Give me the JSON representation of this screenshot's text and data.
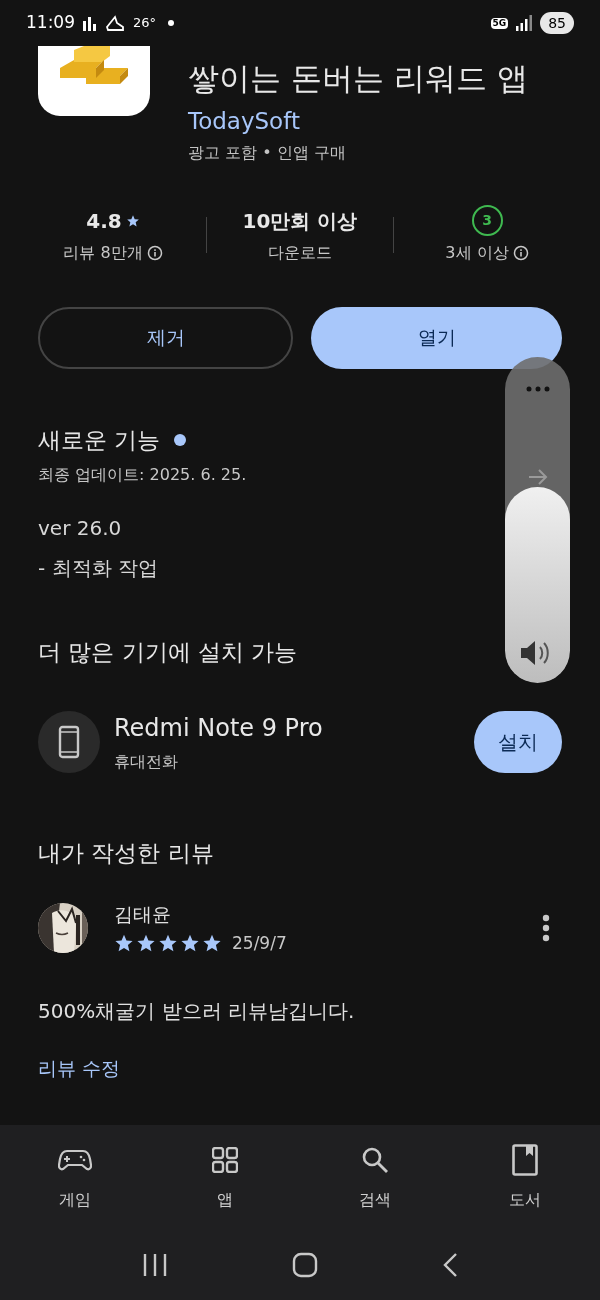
{
  "status_bar": {
    "time": "11:09",
    "temperature": "26°",
    "network": "5G",
    "battery": "85"
  },
  "app": {
    "title": "쌓이는 돈버는 리워드 앱",
    "developer": "TodaySoft",
    "subtitle": "광고 포함 • 인앱 구매"
  },
  "stats": [
    {
      "kind": "rating",
      "value": "4.8",
      "label": "리뷰 8만개",
      "info": true
    },
    {
      "kind": "text",
      "value": "10만회 이상",
      "label": "다운로드",
      "info": false
    },
    {
      "kind": "age",
      "value": "3",
      "label": "3세 이상",
      "info": true
    }
  ],
  "buttons": [
    {
      "label": "제거",
      "kind": "outline"
    },
    {
      "label": "열기",
      "kind": "filled"
    }
  ],
  "whats_new": {
    "title": "새로운 기능",
    "updated": "최종 업데이트: 2025. 6. 25.",
    "notes": [
      "ver 26.0",
      "- 최적화 작업"
    ]
  },
  "devices": {
    "title": "더 많은 기기에 설치 가능",
    "name": "Redmi Note 9 Pro",
    "type": "휴대전화",
    "button": "설치"
  },
  "my_review": {
    "title": "내가 작성한 리뷰",
    "author": "김태윤",
    "stars": 5,
    "date": "25/9/7",
    "text": "500%채굴기 받으러 리뷰남깁니다.",
    "edit_link": "리뷰 수정"
  },
  "bottom_nav": [
    {
      "kind": "games",
      "label": "게임"
    },
    {
      "kind": "apps",
      "label": "앱"
    },
    {
      "kind": "search",
      "label": "검색"
    },
    {
      "kind": "books",
      "label": "도서"
    }
  ],
  "volume": {
    "level": 0.6
  }
}
